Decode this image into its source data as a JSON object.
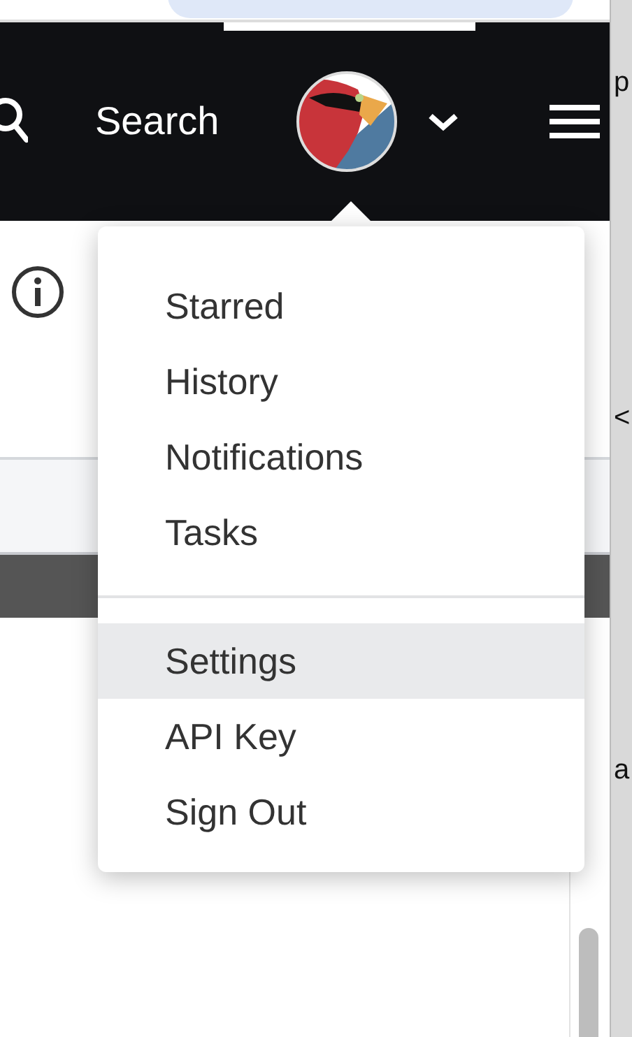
{
  "navbar": {
    "search_label": "Search",
    "menu_open": true
  },
  "dropdown": {
    "groups": [
      [
        {
          "label": "Starred",
          "selected": false
        },
        {
          "label": "History",
          "selected": false
        },
        {
          "label": "Notifications",
          "selected": false
        },
        {
          "label": "Tasks",
          "selected": false
        }
      ],
      [
        {
          "label": "Settings",
          "selected": true
        },
        {
          "label": "API Key",
          "selected": false
        },
        {
          "label": "Sign Out",
          "selected": false
        }
      ]
    ]
  },
  "side_text": [
    "p",
    "<",
    "a"
  ]
}
